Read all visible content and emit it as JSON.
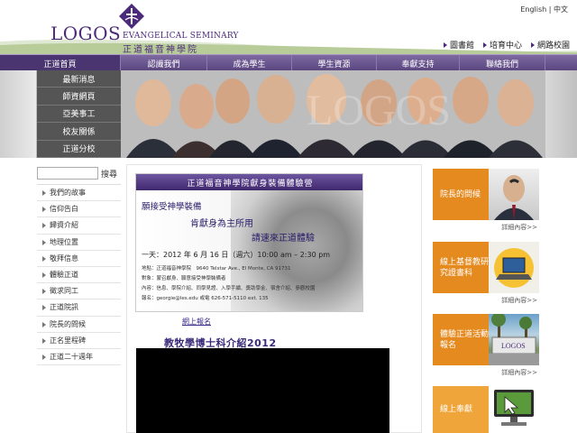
{
  "header": {
    "logo_word": "LOGOS",
    "logo_en": "EVANGELICAL SEMINARY",
    "logo_zh": "正道福音神學院",
    "lang_english": "English",
    "lang_sep": "|",
    "lang_chinese": "中文",
    "util_links": [
      "圖書館",
      "培育中心",
      "網路校園"
    ]
  },
  "nav": {
    "items": [
      "正道首頁",
      "認識我們",
      "成為學生",
      "學生資源",
      "奉獻支持",
      "聯絡我們"
    ]
  },
  "submenu": {
    "items": [
      "最新消息",
      "師資網頁",
      "亞美事工",
      "校友關係",
      "正道分校"
    ]
  },
  "search": {
    "placeholder": "",
    "button": "搜尋"
  },
  "leftnav": {
    "items": [
      "我們的故事",
      "信仰告白",
      "歸資介紹",
      "地理位置",
      "敬拜信息",
      "體驗正道",
      "徵求同工",
      "正道院訊",
      "院長的問候",
      "正名里程碑",
      "正道二十週年"
    ]
  },
  "poster": {
    "head": "正道福音神學院獻身裝備體驗營",
    "line1": "願接受神學裝備",
    "line2": "肯獻身為主所用",
    "line3": "請速來正道體驗",
    "date": "一天：2012 年 6 月 16 日（週六）10:00 am – 2:30 pm",
    "addr": "地點：正道福音神學院　9640 Telstar Ave., El Monte, CA 91731",
    "obj": "對象：蒙召獻身、願意接受神學裝備者",
    "content": "內容：信息、學院介紹、同學見證、入學手續、獎助學金、宿舍介紹、參觀校園",
    "signup": "報名：georgie@les.edu 或電 626-571-5110 ext. 135"
  },
  "center": {
    "signup_link": "網上報名",
    "dmin_title": "教牧學博士科介紹2012"
  },
  "right": {
    "r1_label": "院長的問候",
    "r1_more": "詳細內容>>",
    "r2_label": "線上基督教研究證書科",
    "r2_more": "詳細內容>>",
    "r3_label": "體驗正道活動報名",
    "r3_more": "詳細內容>>",
    "r3_sign": "LOGOS",
    "r4_label": "線上奉獻"
  },
  "colors": {
    "brand_purple": "#4b2a7b",
    "nav_purple": "#6b5690",
    "accent_orange": "#e58a1f"
  }
}
